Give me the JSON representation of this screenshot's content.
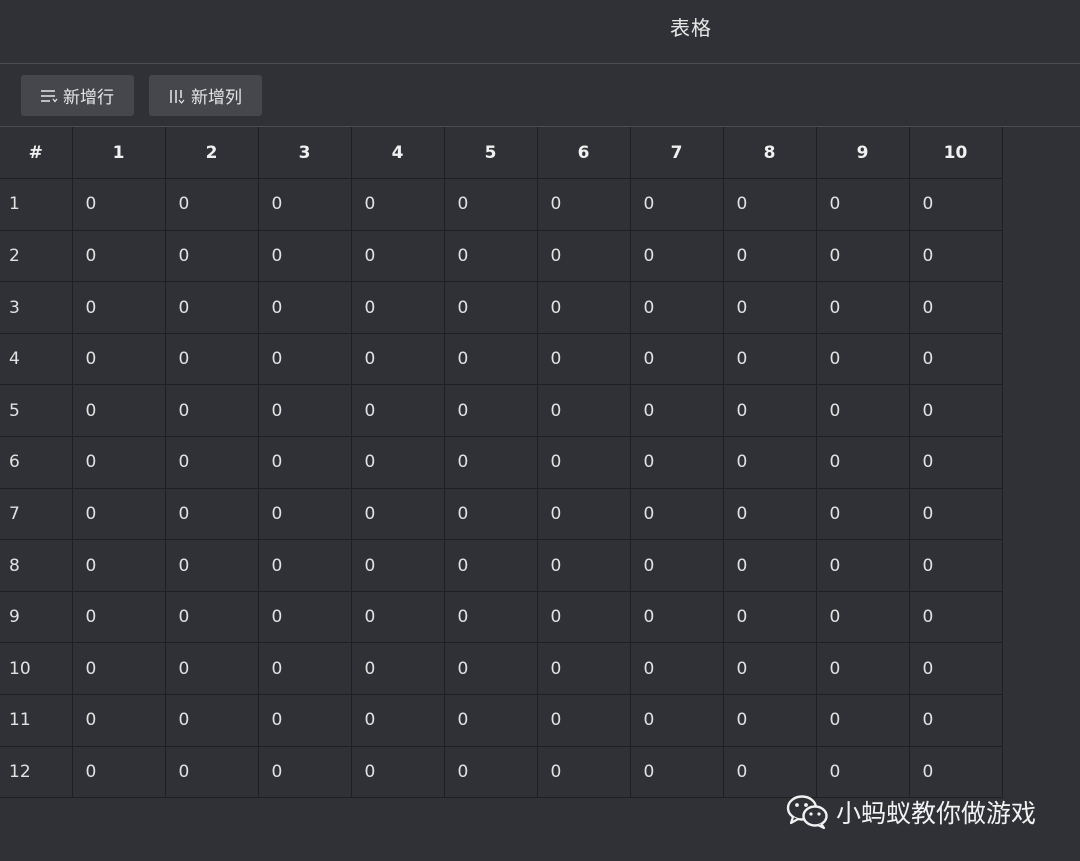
{
  "window": {
    "title": "表格"
  },
  "toolbar": {
    "add_row": {
      "label": "新增行",
      "icon": "add-row-icon"
    },
    "add_col": {
      "label": "新增列",
      "icon": "add-column-icon"
    }
  },
  "table": {
    "corner": "#",
    "columns": [
      "1",
      "2",
      "3",
      "4",
      "5",
      "6",
      "7",
      "8",
      "9",
      "10"
    ],
    "rows": [
      {
        "label": "1",
        "cells": [
          "0",
          "0",
          "0",
          "0",
          "0",
          "0",
          "0",
          "0",
          "0",
          "0"
        ]
      },
      {
        "label": "2",
        "cells": [
          "0",
          "0",
          "0",
          "0",
          "0",
          "0",
          "0",
          "0",
          "0",
          "0"
        ]
      },
      {
        "label": "3",
        "cells": [
          "0",
          "0",
          "0",
          "0",
          "0",
          "0",
          "0",
          "0",
          "0",
          "0"
        ]
      },
      {
        "label": "4",
        "cells": [
          "0",
          "0",
          "0",
          "0",
          "0",
          "0",
          "0",
          "0",
          "0",
          "0"
        ]
      },
      {
        "label": "5",
        "cells": [
          "0",
          "0",
          "0",
          "0",
          "0",
          "0",
          "0",
          "0",
          "0",
          "0"
        ]
      },
      {
        "label": "6",
        "cells": [
          "0",
          "0",
          "0",
          "0",
          "0",
          "0",
          "0",
          "0",
          "0",
          "0"
        ]
      },
      {
        "label": "7",
        "cells": [
          "0",
          "0",
          "0",
          "0",
          "0",
          "0",
          "0",
          "0",
          "0",
          "0"
        ]
      },
      {
        "label": "8",
        "cells": [
          "0",
          "0",
          "0",
          "0",
          "0",
          "0",
          "0",
          "0",
          "0",
          "0"
        ]
      },
      {
        "label": "9",
        "cells": [
          "0",
          "0",
          "0",
          "0",
          "0",
          "0",
          "0",
          "0",
          "0",
          "0"
        ]
      },
      {
        "label": "10",
        "cells": [
          "0",
          "0",
          "0",
          "0",
          "0",
          "0",
          "0",
          "0",
          "0",
          "0"
        ]
      },
      {
        "label": "11",
        "cells": [
          "0",
          "0",
          "0",
          "0",
          "0",
          "0",
          "0",
          "0",
          "0",
          "0"
        ]
      },
      {
        "label": "12",
        "cells": [
          "0",
          "0",
          "0",
          "0",
          "0",
          "0",
          "0",
          "0",
          "0",
          "0"
        ]
      }
    ]
  },
  "watermark": {
    "text": "小蚂蚁教你做游戏",
    "icon": "wechat-icon"
  },
  "colors": {
    "background": "#303136",
    "button": "#46474d",
    "grid_line": "#1e1f23"
  }
}
